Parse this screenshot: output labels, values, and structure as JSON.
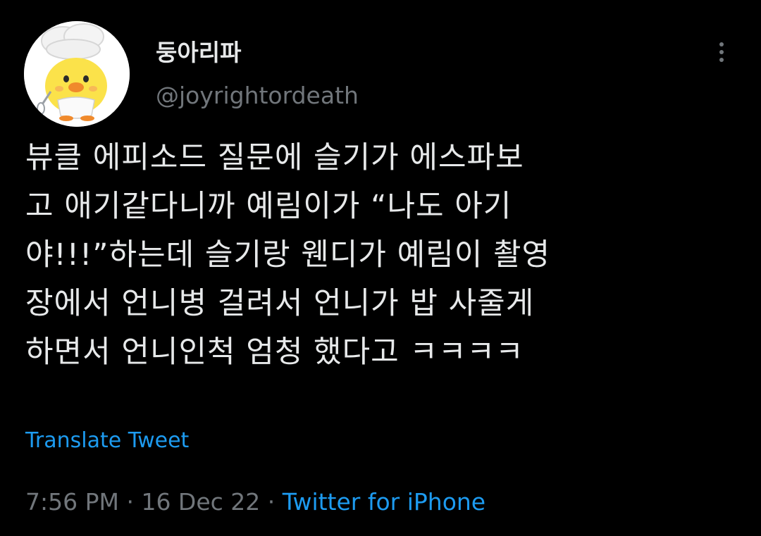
{
  "tweet": {
    "avatar_icon": "chick-chef-avatar",
    "display_name": "둥아리파",
    "handle": "@joyrightordeath",
    "more_icon": "more-vertical-icon",
    "text_lines": [
      "뷰클 에피소드 질문에 슬기가 에스파보",
      "고 애기같다니까 예림이가 “나도 아기",
      "야!!!”하는데 슬기랑 웬디가 예림이 촬영",
      "장에서 언니병 걸려서 언니가 밥 사줄게",
      "하면서 언니인척 엄청 했다고 ㅋㅋㅋㅋ"
    ],
    "translate_label": "Translate Tweet",
    "time": "7:56 PM",
    "separator_1": " · ",
    "date": "16 Dec 22",
    "separator_2": " · ",
    "source": "Twitter for iPhone"
  },
  "colors": {
    "background": "#000000",
    "text_primary": "#e7e9ea",
    "text_secondary": "#71767b",
    "accent": "#1d9bf0"
  }
}
